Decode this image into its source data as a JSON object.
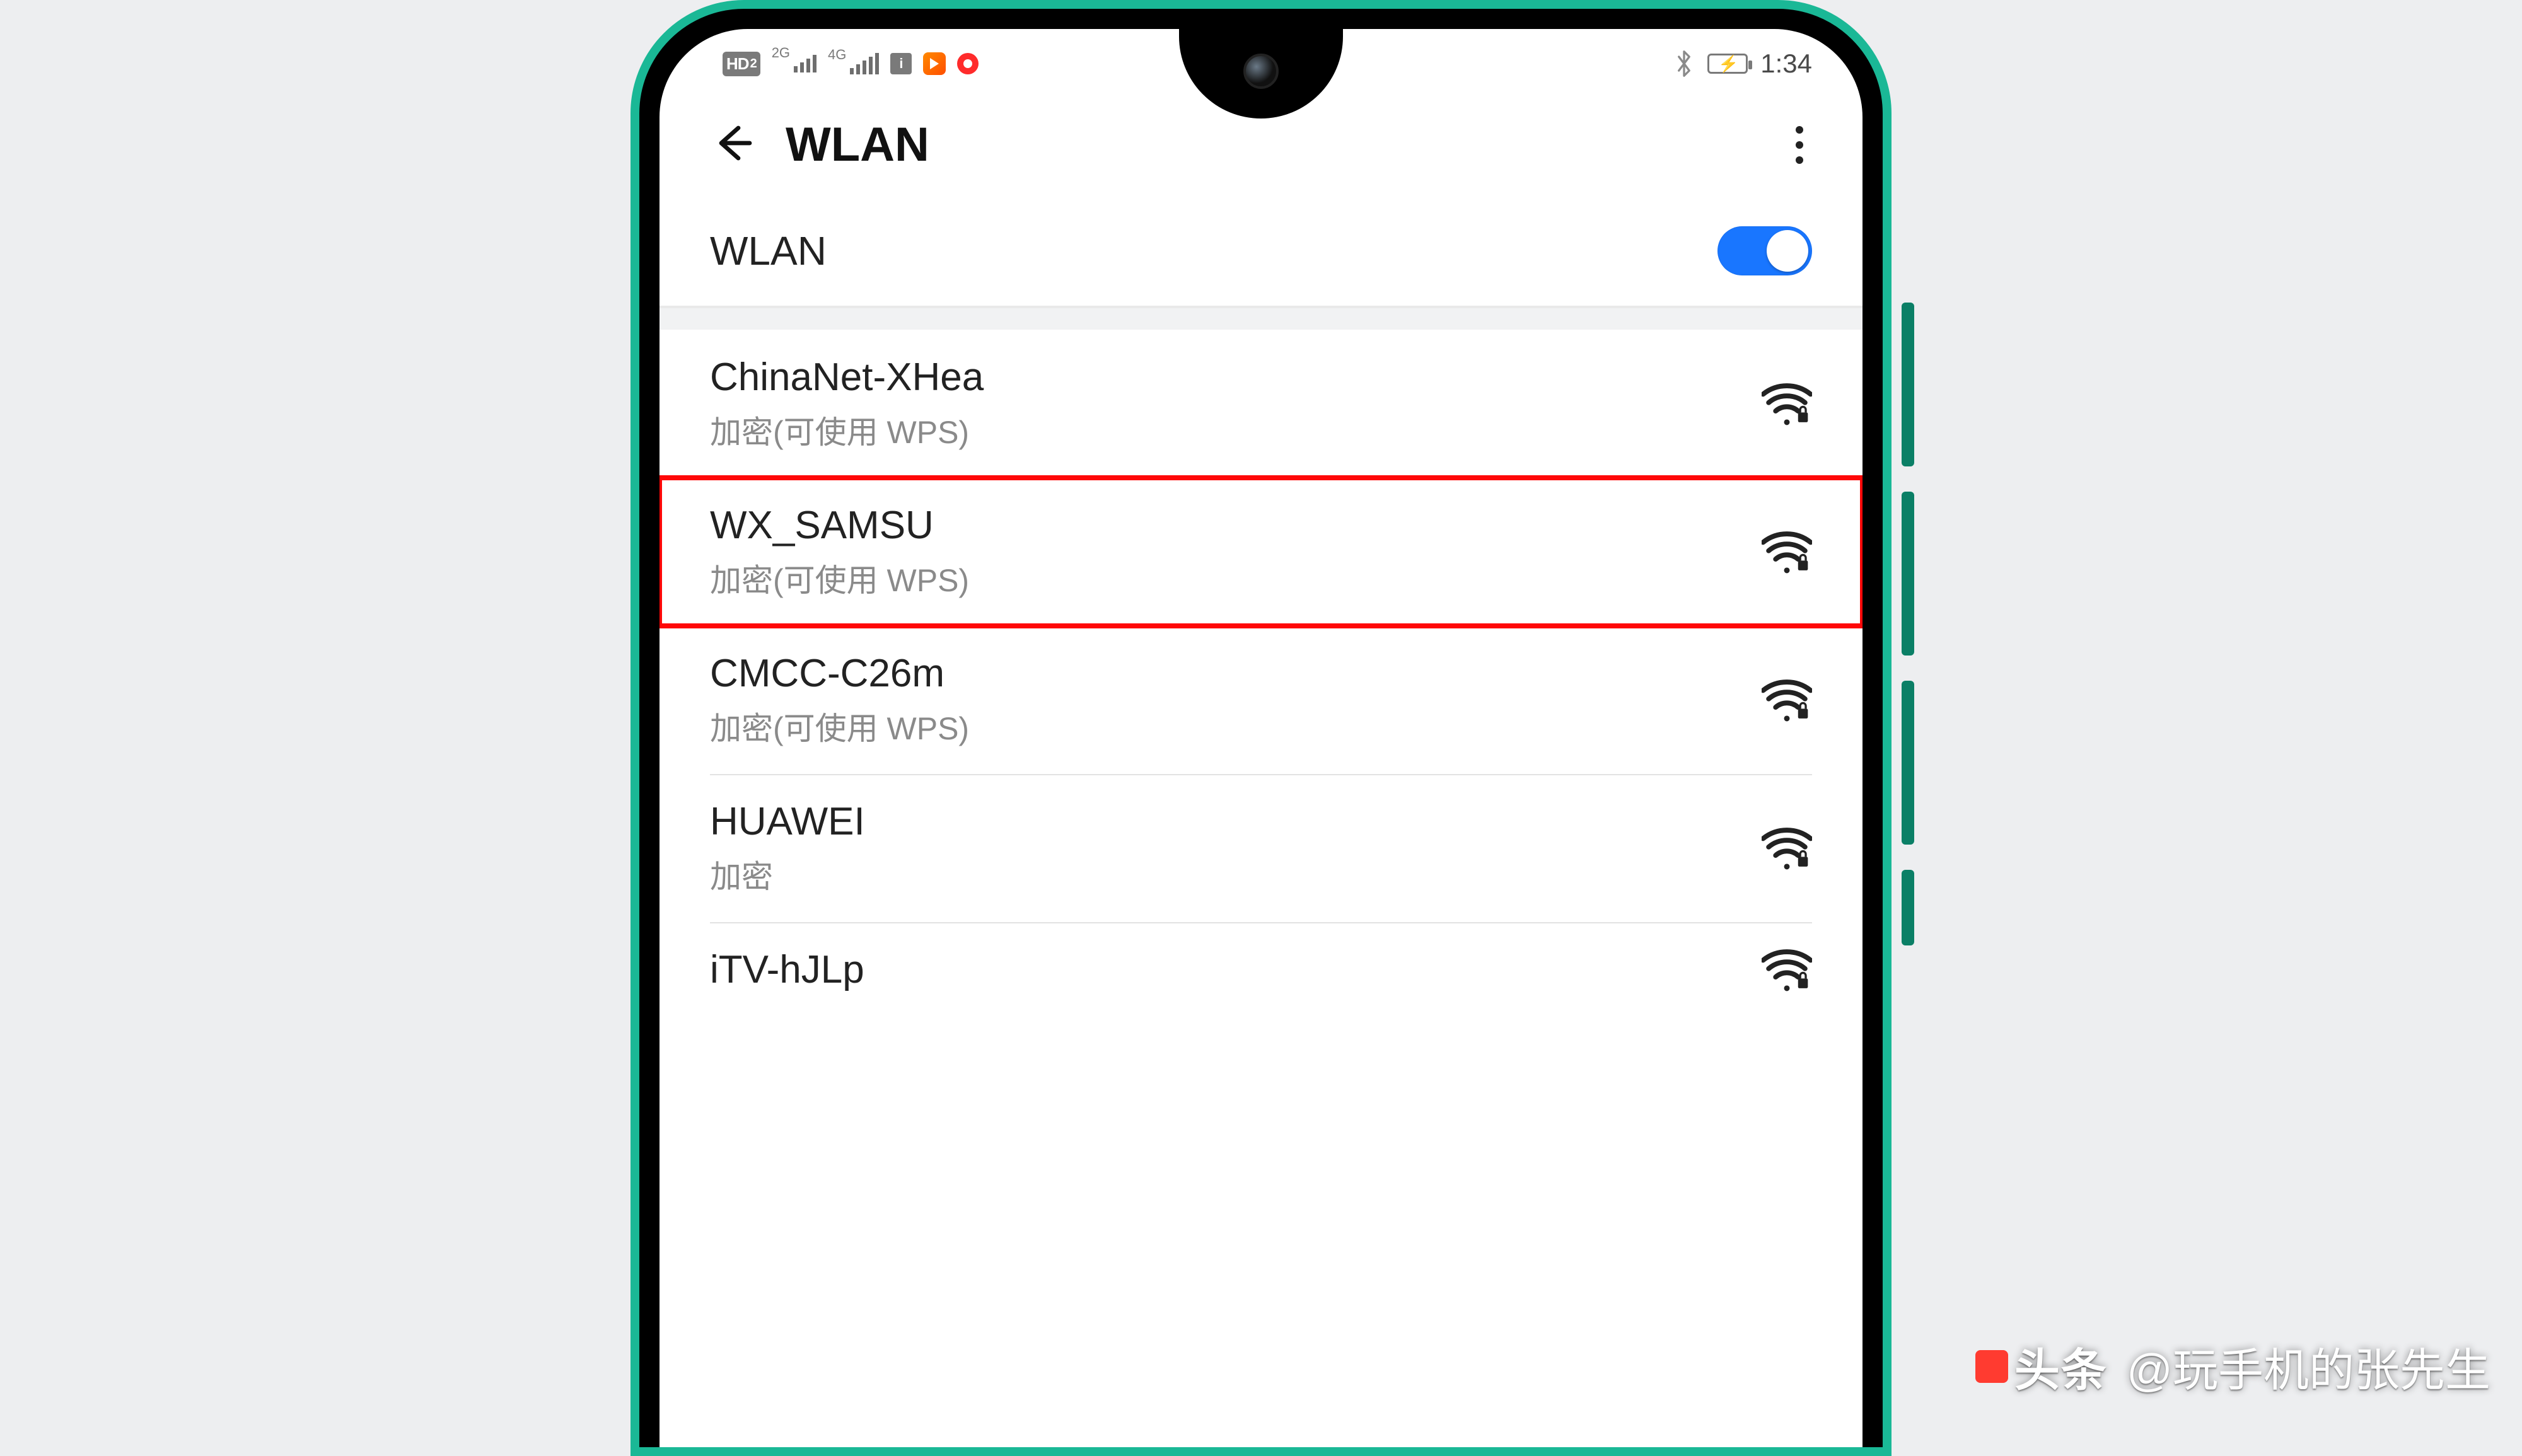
{
  "statusbar": {
    "hd_label": "HD",
    "hd_sub": "2",
    "sig1_label": "2G",
    "sig2_label": "4G",
    "time": "1:34"
  },
  "header": {
    "title": "WLAN"
  },
  "toggle": {
    "label": "WLAN",
    "on": true
  },
  "networks": [
    {
      "ssid": "ChinaNet-XHea",
      "detail": "加密(可使用 WPS)",
      "highlight": false
    },
    {
      "ssid": "WX_SAMSU",
      "detail": "加密(可使用 WPS)",
      "highlight": true
    },
    {
      "ssid": "CMCC-C26m",
      "detail": "加密(可使用 WPS)",
      "highlight": false
    },
    {
      "ssid": "HUAWEI",
      "detail": "加密",
      "highlight": false
    },
    {
      "ssid": "iTV-hJLp",
      "detail": "",
      "highlight": false
    }
  ],
  "watermark": {
    "brand": "头条",
    "handle": "@玩手机的张先生"
  }
}
